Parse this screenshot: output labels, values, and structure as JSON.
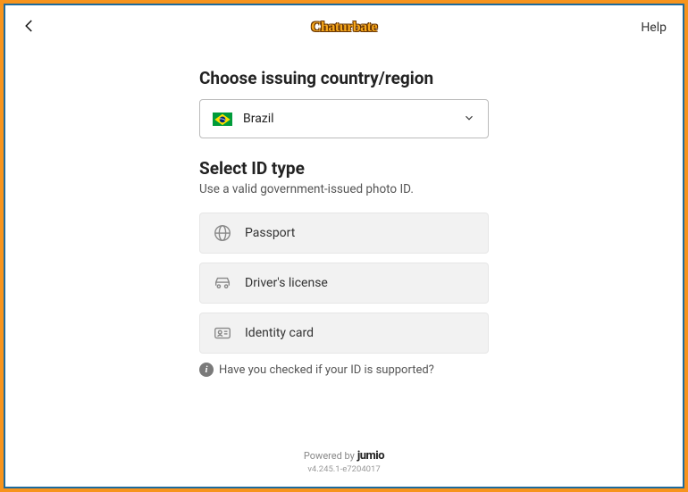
{
  "header": {
    "help_label": "Help"
  },
  "logo_text": "Chaturbate",
  "country_section": {
    "title": "Choose issuing country/region",
    "selected": "Brazil"
  },
  "id_section": {
    "title": "Select ID type",
    "subtitle": "Use a valid government-issued photo ID.",
    "options": {
      "passport": "Passport",
      "drivers_license": "Driver's license",
      "identity_card": "Identity card"
    }
  },
  "hint": {
    "text": "Have you checked if your ID is supported?",
    "icon_letter": "i"
  },
  "footer": {
    "powered_by": "Powered by",
    "brand": "jumio",
    "version": "v4.245.1-e7204017"
  }
}
